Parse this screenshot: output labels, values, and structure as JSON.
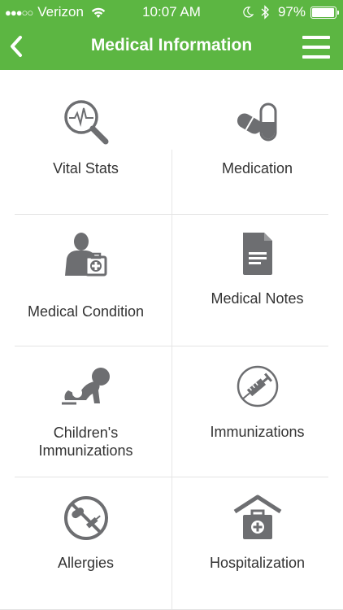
{
  "status": {
    "carrier": "Verizon",
    "time": "10:07 AM",
    "battery": "97%",
    "battery_level": 0.97
  },
  "header": {
    "title": "Medical Information"
  },
  "tiles": [
    {
      "label": "Vital Stats",
      "icon": "magnifier-heartbeat-icon"
    },
    {
      "label": "Medication",
      "icon": "pills-icon"
    },
    {
      "label": "Medical Condition",
      "icon": "patient-medkit-icon"
    },
    {
      "label": "Medical Notes",
      "icon": "document-icon"
    },
    {
      "label": "Children's Immunizations",
      "icon": "crawling-baby-icon"
    },
    {
      "label": "Immunizations",
      "icon": "syringe-icon"
    },
    {
      "label": "Allergies",
      "icon": "no-medication-icon"
    },
    {
      "label": "Hospitalization",
      "icon": "hospital-icon"
    }
  ],
  "colors": {
    "brand_green": "#5cb642",
    "icon_gray": "#6d6e71",
    "text": "#333333"
  }
}
